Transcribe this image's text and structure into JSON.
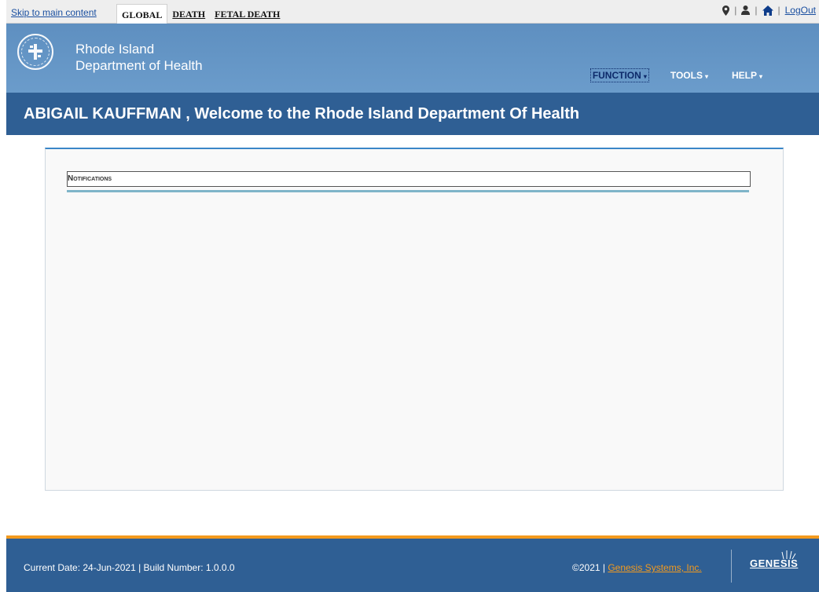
{
  "topbar": {
    "skip_link": "Skip to main content",
    "tabs": [
      {
        "label": "GLOBAL",
        "active": true
      },
      {
        "label": "DEATH",
        "active": false
      },
      {
        "label": "FETAL DEATH",
        "active": false
      }
    ],
    "icons": [
      "map-marker-icon",
      "user-icon",
      "home-icon"
    ],
    "separator": "|",
    "logout": "LogOut"
  },
  "header": {
    "org_line1": "Rhode Island",
    "org_line2": "Department of Health",
    "nav": [
      {
        "label": "FUNCTION",
        "current": true
      },
      {
        "label": "TOOLS",
        "current": false
      },
      {
        "label": "HELP",
        "current": false
      }
    ]
  },
  "welcome": {
    "text": "ABIGAIL KAUFFMAN , Welcome to the Rhode Island Department Of Health"
  },
  "main": {
    "notifications_label": "Notifications"
  },
  "footer": {
    "left_text": "Current Date: 24-Jun-2021 | Build Number: 1.0.0.0",
    "copyright": "©2021 | ",
    "company_link": "Genesis Systems, Inc.",
    "brand": "GENESIS"
  },
  "colors": {
    "header": "#6b9ccb",
    "dark_blue": "#2f5f94",
    "accent_orange": "#f39a1e",
    "panel_border": "#3a86c8"
  }
}
